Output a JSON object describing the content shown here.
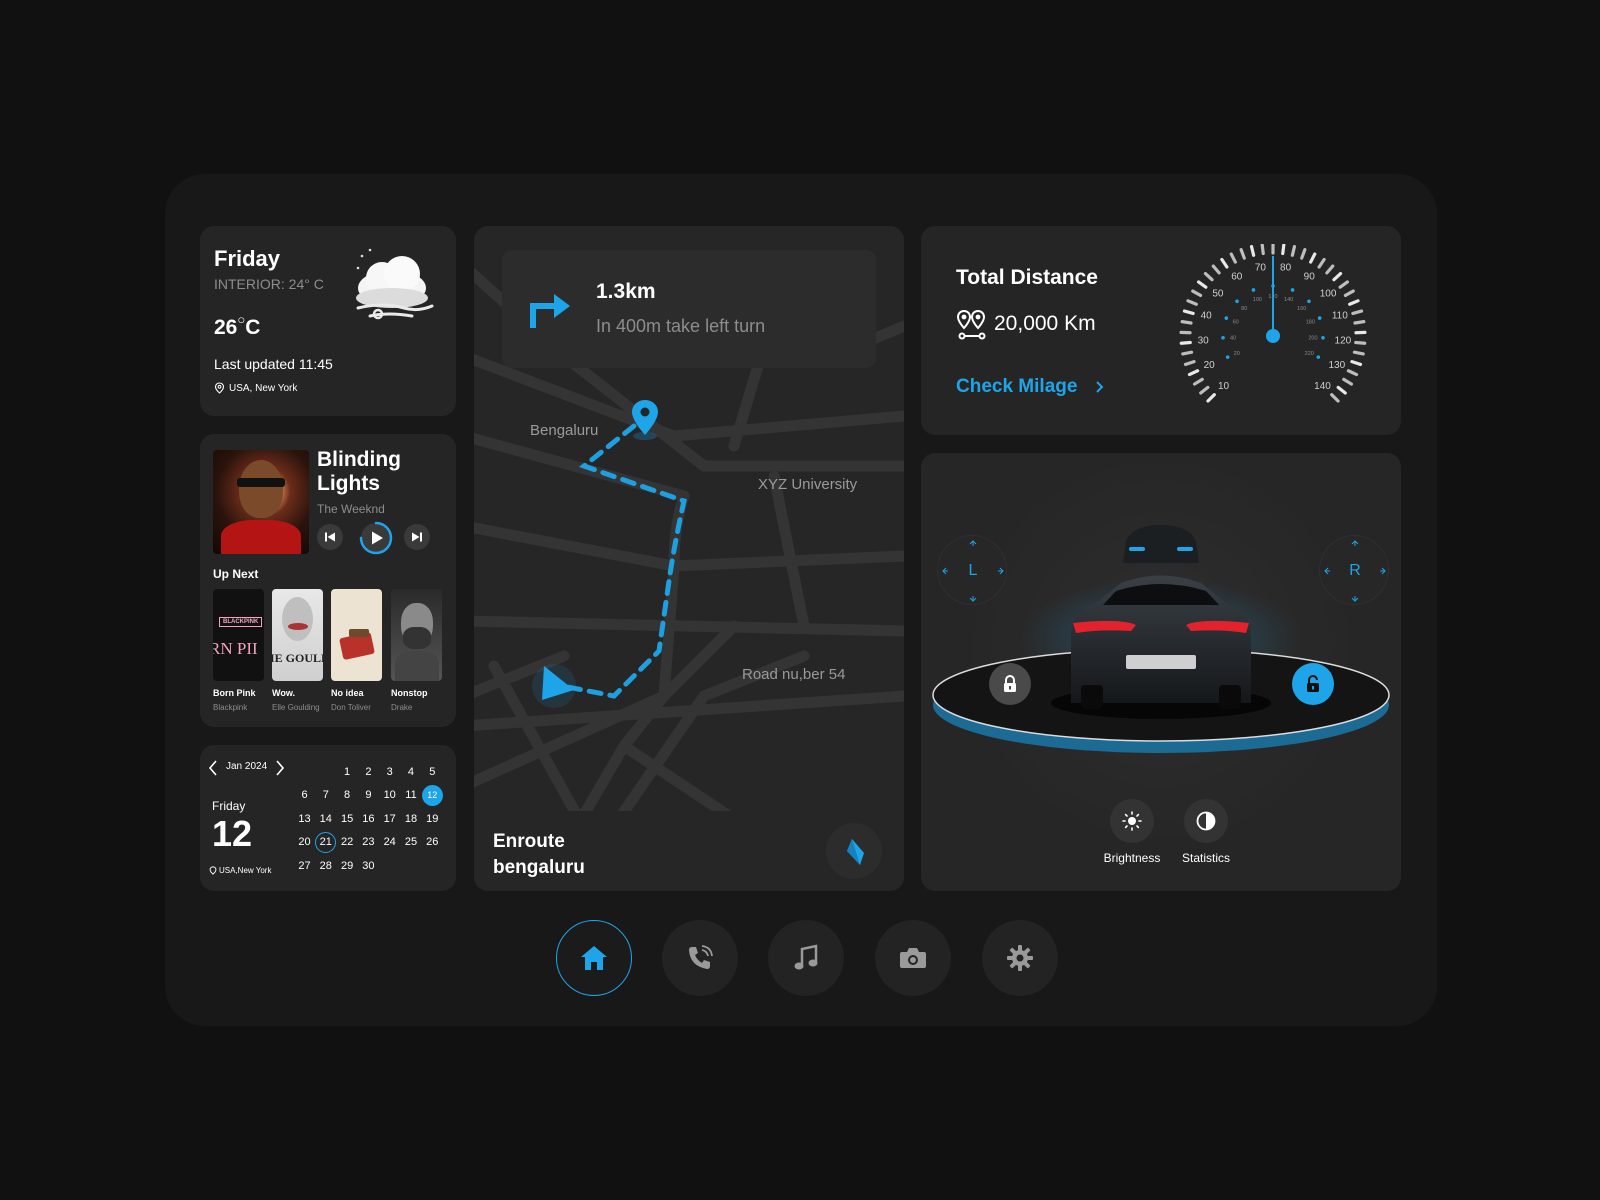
{
  "weather": {
    "day": "Friday",
    "interior": "INTERIOR: 24° C",
    "temp_value": "26",
    "temp_unit": "C",
    "updated": "Last updated 11:45",
    "location": "USA, New York",
    "icon": "cloud-moon-wind-icon"
  },
  "music": {
    "title": "Blinding Lights",
    "artist": "The Weeknd",
    "up_next_label": "Up Next",
    "playback_progress": 0.75,
    "up_next": [
      {
        "title": "Born Pink",
        "artist": "Blackpink",
        "cover_text_top": "BLACKPINK",
        "cover_text_main": "RN PII"
      },
      {
        "title": "Wow.",
        "artist": "Elle Goulding",
        "cover_text_main": "IE GOULD"
      },
      {
        "title": "No idea",
        "artist": "Don Toliver"
      },
      {
        "title": "Nonstop",
        "artist": "Drake"
      }
    ]
  },
  "calendar": {
    "month": "Jan 2024",
    "weekday": "Friday",
    "day": "12",
    "location": "USA,New York",
    "selected_day": 12,
    "today": 21,
    "leading_blanks": 2,
    "days_in_month": 30
  },
  "map": {
    "distance": "1.3km",
    "instruction": "In 400m take left turn",
    "labels": {
      "bengaluru": "Bengaluru",
      "university": "XYZ University",
      "road": "Road nu,ber 54"
    },
    "enroute_line1": "Enroute",
    "enroute_line2": "bengaluru",
    "accent": "#1ea5e9"
  },
  "distance": {
    "title": "Total Distance",
    "value": "20,000 Km",
    "check_label": "Check Milage",
    "gauge": {
      "outer_labels": [
        "10",
        "20",
        "30",
        "40",
        "50",
        "60",
        "70",
        "80",
        "90",
        "100",
        "110",
        "120",
        "130",
        "140"
      ],
      "inner_labels": [
        "20",
        "40",
        "60",
        "80",
        "100",
        "120",
        "140",
        "160",
        "180",
        "200",
        "220"
      ],
      "needle_value": 75
    }
  },
  "car": {
    "left_pad": "L",
    "right_pad": "R",
    "options": [
      {
        "label": "Brightness",
        "icon": "sun-icon"
      },
      {
        "label": "Statistics",
        "icon": "contrast-icon"
      }
    ]
  },
  "bottom_nav": [
    {
      "name": "home",
      "icon": "home-icon",
      "active": true
    },
    {
      "name": "phone",
      "icon": "phone-icon",
      "active": false
    },
    {
      "name": "music",
      "icon": "music-note-icon",
      "active": false
    },
    {
      "name": "camera",
      "icon": "camera-icon",
      "active": false
    },
    {
      "name": "settings",
      "icon": "gear-icon",
      "active": false
    }
  ],
  "colors": {
    "background": "#111111",
    "panel": "#252525",
    "accent": "#1ea5e9"
  }
}
